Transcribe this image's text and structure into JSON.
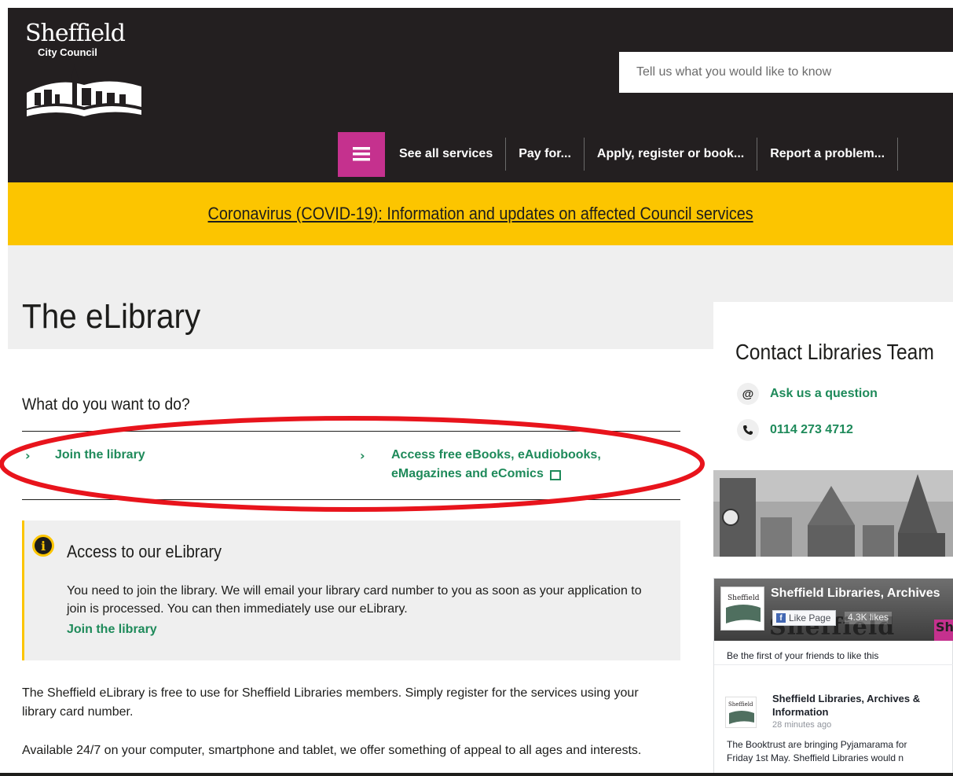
{
  "header": {
    "logo_line1": "Sheffield",
    "logo_line2": "City Council",
    "search_placeholder": "Tell us what you would like to know",
    "menu_icon": "hamburger-icon",
    "nav": [
      "See all services",
      "Pay for...",
      "Apply, register or book...",
      "Report a problem..."
    ]
  },
  "banner": {
    "text": "Coronavirus (COVID-19): Information and updates on affected Council services"
  },
  "page": {
    "title": "The eLibrary",
    "tasks_heading": "What do you want to do?",
    "task_join": "Join the library",
    "task_access_line1": "Access free eBooks, eAudiobooks,",
    "task_access_line2": "eMagazines and eComics"
  },
  "info_box": {
    "heading": "Access to our eLibrary",
    "body": "You need to join the library. We will email your library card number to you as soon as your application to join is processed. You can then immediately use our eLibrary.",
    "link": "Join the library"
  },
  "body": {
    "para1": "The Sheffield eLibrary is free to use for Sheffield Libraries members. Simply register for the services using your library card number.",
    "para2": "Available 24/7 on your computer, smartphone and tablet, we offer something of appeal to all ages and interests."
  },
  "sidebar": {
    "contact_title": "Contact Libraries Team",
    "ask": "Ask us a question",
    "phone": "0114 273 4712"
  },
  "facebook": {
    "page_name": "Sheffield Libraries, Archives",
    "like_label": "Like Page",
    "likes": "4.3K likes",
    "cover_text": "Sheffield",
    "friends_text": "Be the first of your friends to like this",
    "post_author": "Sheffield Libraries, Archives & Information",
    "post_time": "28 minutes ago",
    "post_line1": "The Booktrust are bringing Pyjamarama for",
    "post_line2": "Friday 1st May. Sheffield Libraries would n"
  },
  "colors": {
    "header_bg": "#231f20",
    "banner_yellow": "#fcc500",
    "menu_magenta": "#c5318e",
    "link_green": "#1e8a5a",
    "annotation_red": "#e8141c"
  }
}
